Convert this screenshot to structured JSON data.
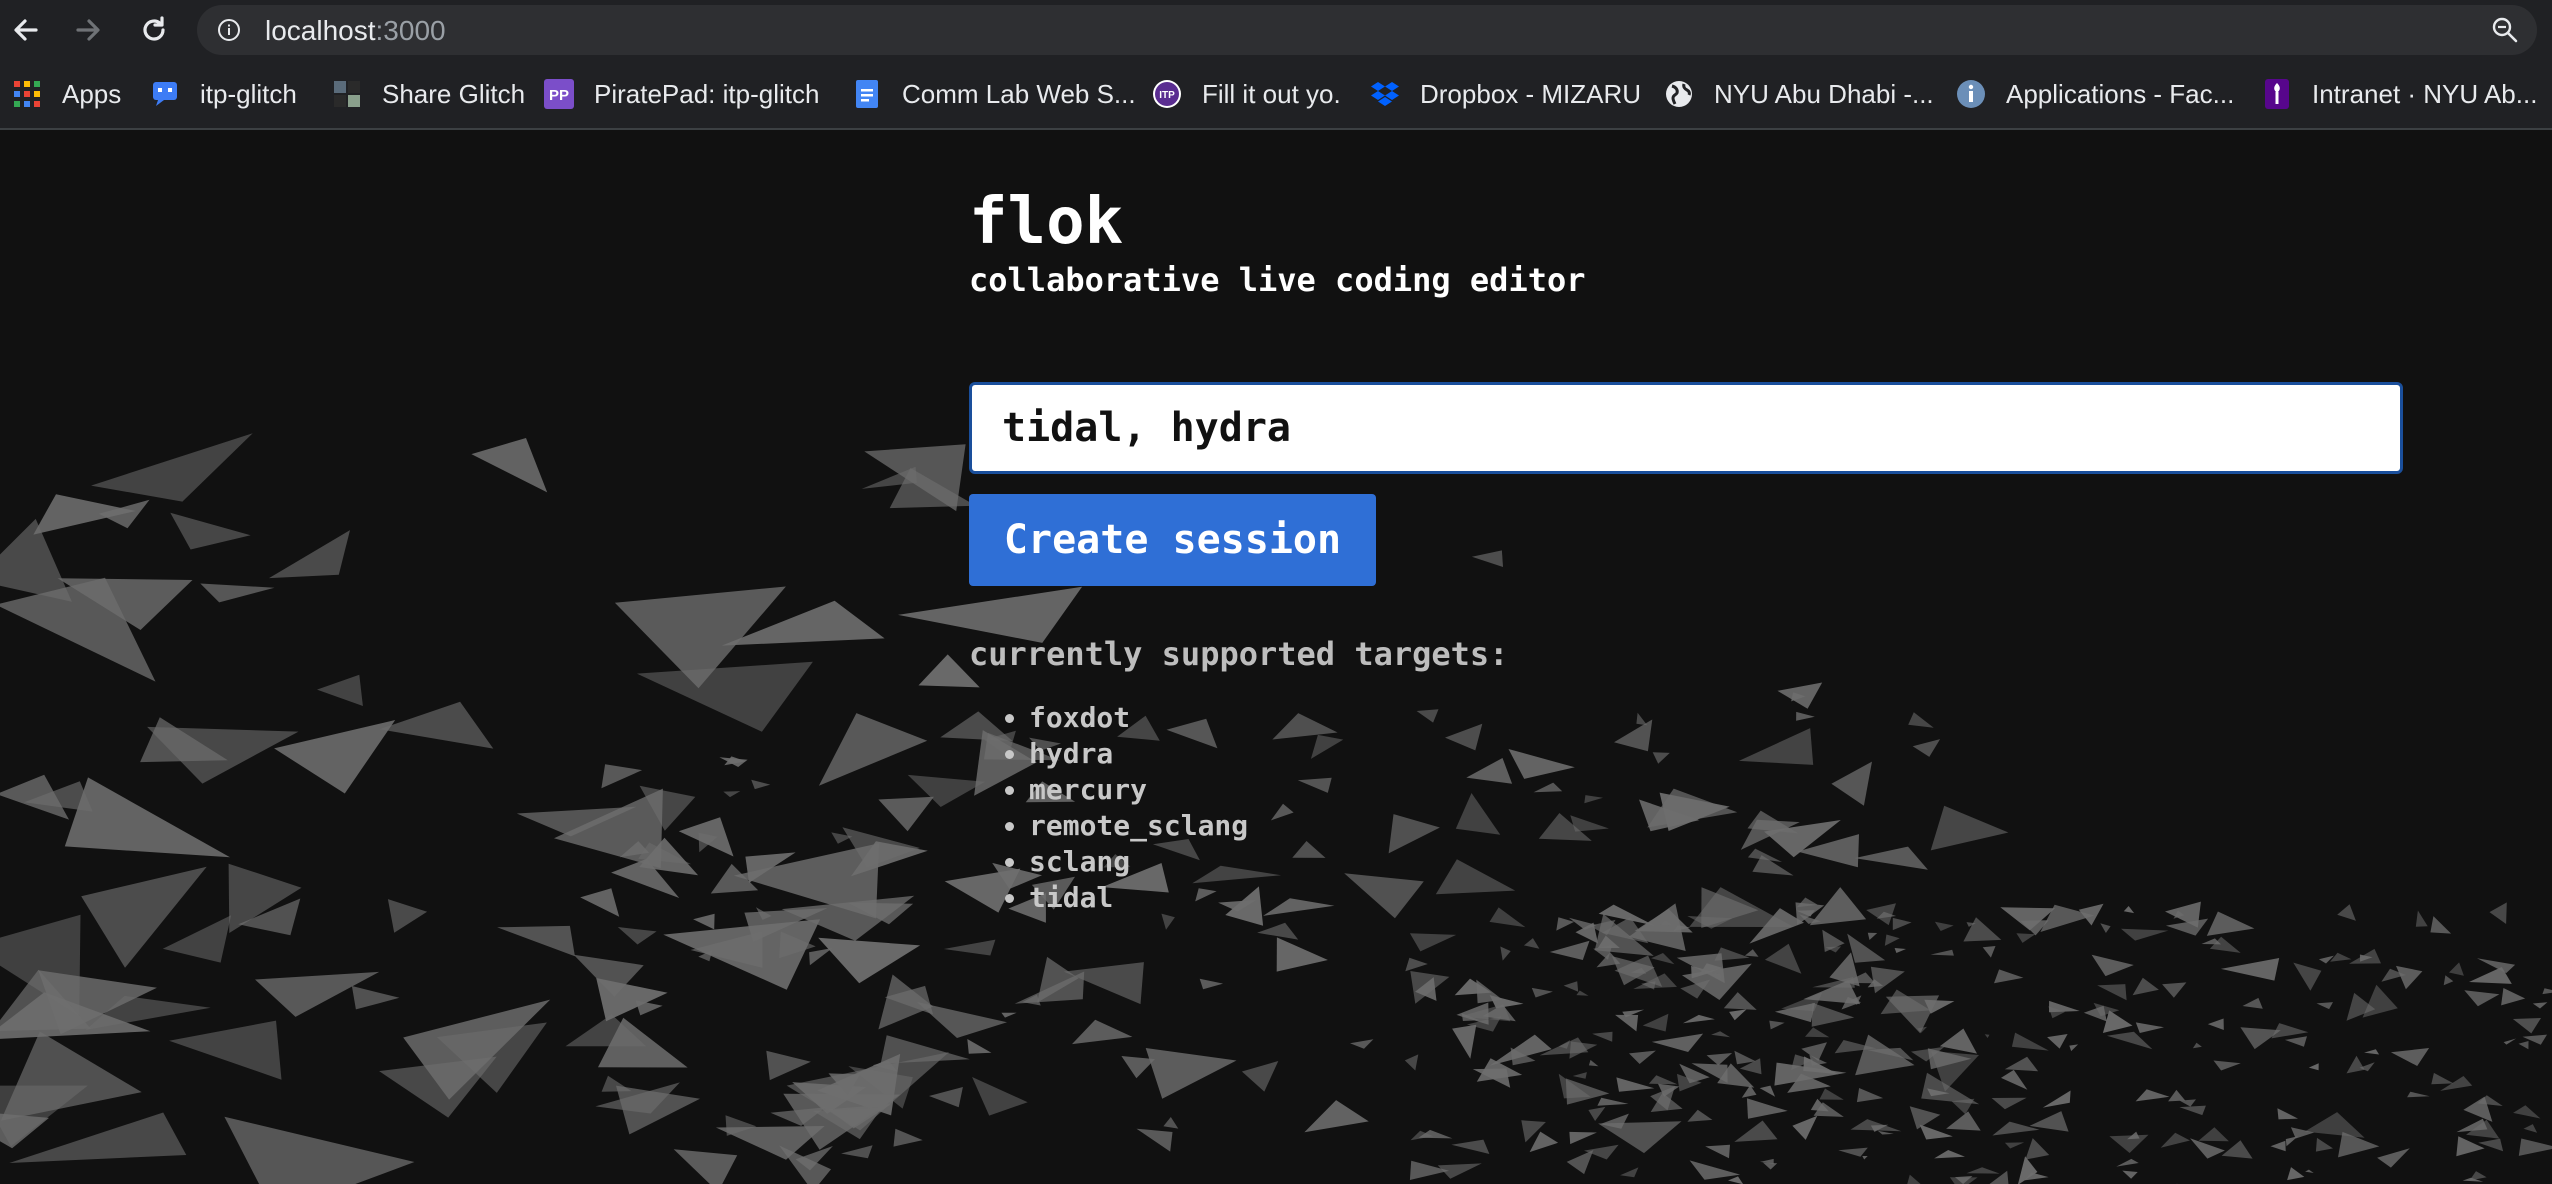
{
  "browser": {
    "url_host": "localhost",
    "url_port": ":3000",
    "bookmarks": [
      {
        "label": "Apps",
        "icon": "apps-grid-icon"
      },
      {
        "label": "itp-glitch",
        "icon": "glitch-icon"
      },
      {
        "label": "Share Glitch",
        "icon": "share-glitch-icon"
      },
      {
        "label": "PiratePad: itp-glitch",
        "icon": "piratepad-icon"
      },
      {
        "label": "Comm Lab Web S...",
        "icon": "google-docs-icon"
      },
      {
        "label": "Fill it out yo.",
        "icon": "itp-icon"
      },
      {
        "label": "Dropbox - MIZARU",
        "icon": "dropbox-icon"
      },
      {
        "label": "NYU Abu Dhabi -...",
        "icon": "globe-icon"
      },
      {
        "label": "Applications - Fac...",
        "icon": "info-icon"
      },
      {
        "label": "Intranet · NYU Ab...",
        "icon": "nyu-torch-icon"
      }
    ]
  },
  "page": {
    "title": "flok",
    "subtitle": "collaborative live coding editor",
    "session_input_value": "tidal, hydra",
    "create_button_label": "Create session",
    "targets_heading": "currently supported targets:",
    "targets": [
      "foxdot",
      "hydra",
      "mercury",
      "remote_sclang",
      "sclang",
      "tidal"
    ]
  },
  "colors": {
    "page_background": "#111111",
    "button_blue": "#2f6fd6",
    "flock_shapes": "#6e6e6e"
  }
}
